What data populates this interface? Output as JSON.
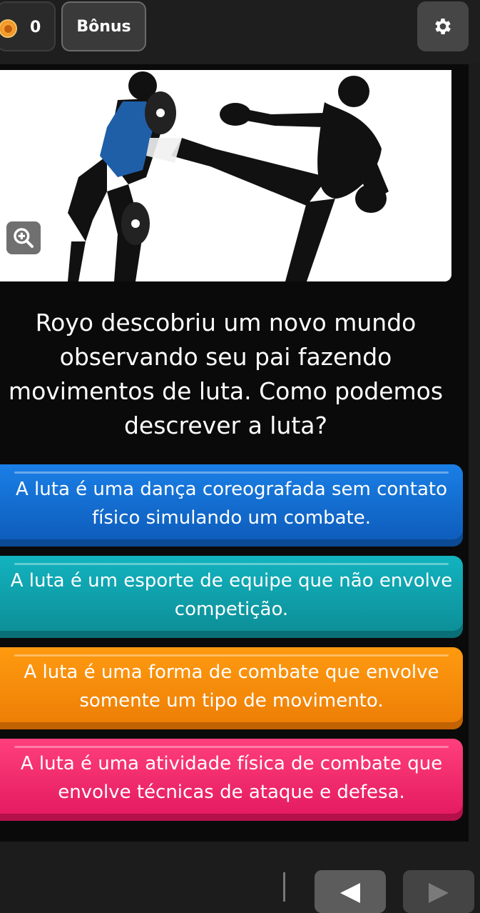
{
  "topbar": {
    "score": "0",
    "bonus_label": "Bônus",
    "coin_icon": "coin-icon",
    "settings_icon": "gear-icon"
  },
  "question": {
    "text": "Royo descobriu um novo mundo observando seu pai fazendo movimentos de luta. Como podemos descrever a luta?",
    "zoom_icon": "zoom-in-icon"
  },
  "answers": [
    {
      "text": "A luta é uma dança coreografada sem contato físico simulando um combate.",
      "color": "#1a7fe6"
    },
    {
      "text": "A luta é um esporte de equipe que não envolve competição.",
      "color": "#12b3c0"
    },
    {
      "text": "A luta é uma forma de combate que envolve somente um tipo de movimento.",
      "color": "#ff9a10"
    },
    {
      "text": "A luta é uma atividade física de combate que envolve técnicas de ataque e defesa.",
      "color": "#ff3f7d"
    }
  ],
  "navigation": {
    "prev_icon": "arrow-left-icon",
    "next_icon": "arrow-right-icon"
  }
}
